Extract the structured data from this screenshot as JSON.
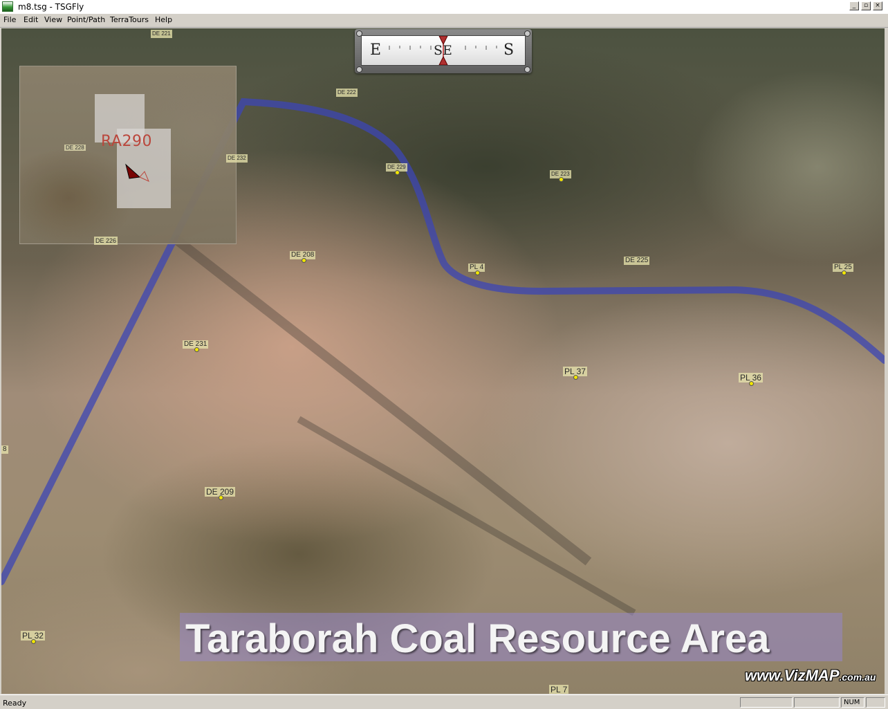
{
  "window": {
    "title": "m8.tsg - TSGFly",
    "minimize": "_",
    "restore": "▫",
    "close": "×"
  },
  "menu": [
    "File",
    "Edit",
    "View",
    "Point/Path",
    "TerraTours",
    "Help"
  ],
  "compass": {
    "left": "E",
    "center": "SE",
    "right": "S",
    "heading": "SE"
  },
  "inset_map": {
    "area_label": "RA290",
    "de_label": "DE 228"
  },
  "map_labels": [
    {
      "text": "DE 221"
    },
    {
      "text": "DE 222"
    },
    {
      "text": "DE 232"
    },
    {
      "text": "DE 229"
    },
    {
      "text": "DE 223"
    },
    {
      "text": "DE 226"
    },
    {
      "text": "DE 208"
    },
    {
      "text": "PL 4"
    },
    {
      "text": "DE 225"
    },
    {
      "text": "PL 25"
    },
    {
      "text": "DE 231"
    },
    {
      "text": "PL 37"
    },
    {
      "text": "PL 36"
    },
    {
      "text": "DE 209"
    },
    {
      "text": "PL 32"
    },
    {
      "text": "PL 7"
    },
    {
      "text": "8"
    }
  ],
  "banner": {
    "text": "Taraborah Coal Resource Area"
  },
  "watermark": {
    "main": "www.VizMAP",
    "suffix": ".com.au"
  },
  "status": {
    "text": "Ready",
    "num": "NUM"
  },
  "colors": {
    "flight_path": "#3c46b4",
    "banner_bg": "#9687c8",
    "inset_label": "#c0463c",
    "label_bg": "#e6e1aa"
  }
}
